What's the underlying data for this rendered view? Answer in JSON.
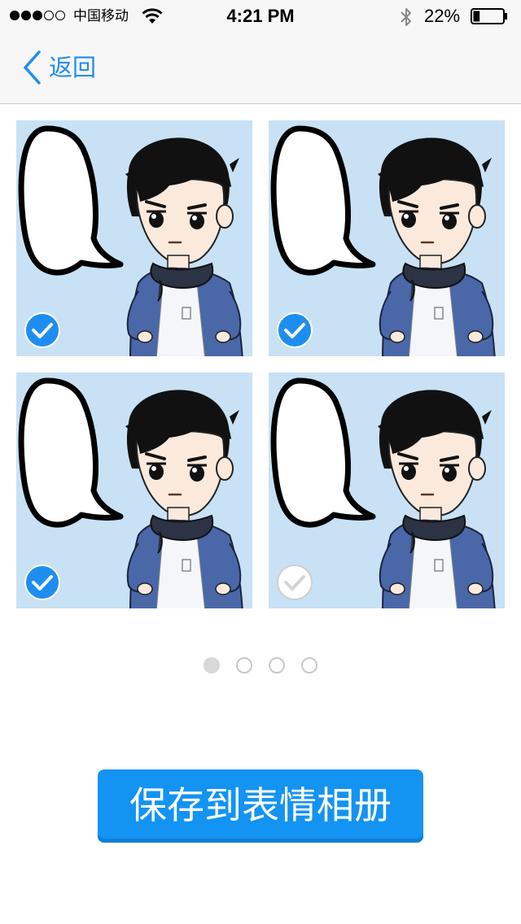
{
  "status_bar": {
    "carrier": "中国移动",
    "time": "4:21 PM",
    "battery_percent": "22%",
    "signal_strength": 3,
    "battery_level": 0.22
  },
  "nav": {
    "back_label": "返回"
  },
  "stickers": [
    {
      "selected": true
    },
    {
      "selected": true
    },
    {
      "selected": true
    },
    {
      "selected": false
    }
  ],
  "pager": {
    "count": 4,
    "current": 1
  },
  "save_button": {
    "label": "保存到表情相册"
  },
  "colors": {
    "accent": "#1d8ef0",
    "button": "#1393f2",
    "sticker_bg": "#c8e1f4",
    "scarf": "#2b3345",
    "jacket": "#4a67a8"
  }
}
